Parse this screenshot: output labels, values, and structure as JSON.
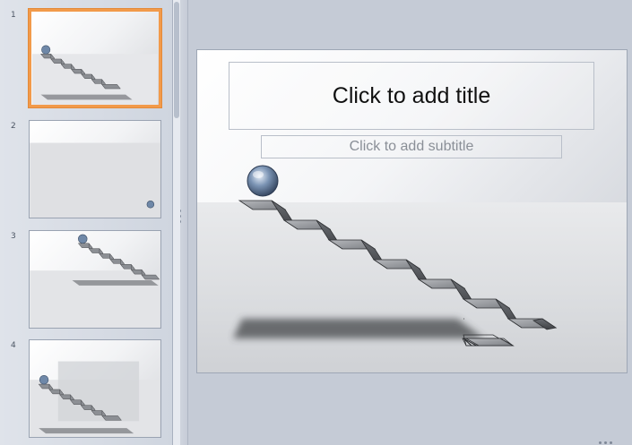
{
  "slides": [
    {
      "number": "1",
      "selected": true
    },
    {
      "number": "2",
      "selected": false
    },
    {
      "number": "3",
      "selected": false
    },
    {
      "number": "4",
      "selected": false
    }
  ],
  "main_slide": {
    "title_placeholder": "Click to add title",
    "subtitle_placeholder": "Click to add subtitle"
  },
  "colors": {
    "selection_border": "#f29a4a",
    "background": "#c5cbd6"
  },
  "icons": [
    "sphere-icon",
    "staircase-graphic",
    "splitter-grip-icon"
  ]
}
